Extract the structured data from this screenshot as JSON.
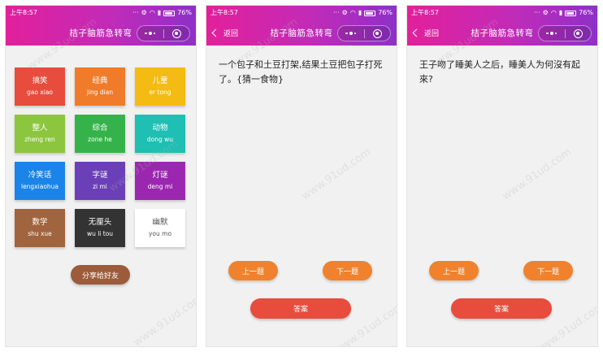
{
  "status": {
    "time": "上午8:57",
    "battery": "76%",
    "icons": [
      "...",
      "⚙",
      "wifi",
      "signal"
    ]
  },
  "app": {
    "title": "桔子脑筋急转弯",
    "back_label": "返回"
  },
  "watermark": "www.91ud.com",
  "categories": [
    {
      "name": "搞笑",
      "pinyin": "gao xiao",
      "color": "#e74c3c"
    },
    {
      "name": "经典",
      "pinyin": "jing dian",
      "color": "#f07b2a"
    },
    {
      "name": "儿童",
      "pinyin": "er tong",
      "color": "#f4bb13"
    },
    {
      "name": "整人",
      "pinyin": "zheng ren",
      "color": "#8cc63f"
    },
    {
      "name": "综合",
      "pinyin": "zone he",
      "color": "#35b34a"
    },
    {
      "name": "动物",
      "pinyin": "dong wu",
      "color": "#1fbfb3"
    },
    {
      "name": "冷笑话",
      "pinyin": "lengxiaohua",
      "color": "#1b84e8"
    },
    {
      "name": "字谜",
      "pinyin": "zi mi",
      "color": "#6b3fb8"
    },
    {
      "name": "灯谜",
      "pinyin": "deng mi",
      "color": "#9b27b0"
    },
    {
      "name": "数学",
      "pinyin": "shu xue",
      "color": "#a0643e"
    },
    {
      "name": "无厘头",
      "pinyin": "wu li tou",
      "color": "#333333"
    },
    {
      "name": "幽默",
      "pinyin": "you mo",
      "color": "#ffffff"
    }
  ],
  "share_label": "分享给好友",
  "questions": [
    {
      "text": "一个包子和土豆打架,结果土豆把包子打死了。{猜一食物}"
    },
    {
      "text": "王子吻了睡美人之后，睡美人为何沒有起來?"
    }
  ],
  "buttons": {
    "prev": "上一题",
    "next": "下一题",
    "answer": "答案"
  }
}
